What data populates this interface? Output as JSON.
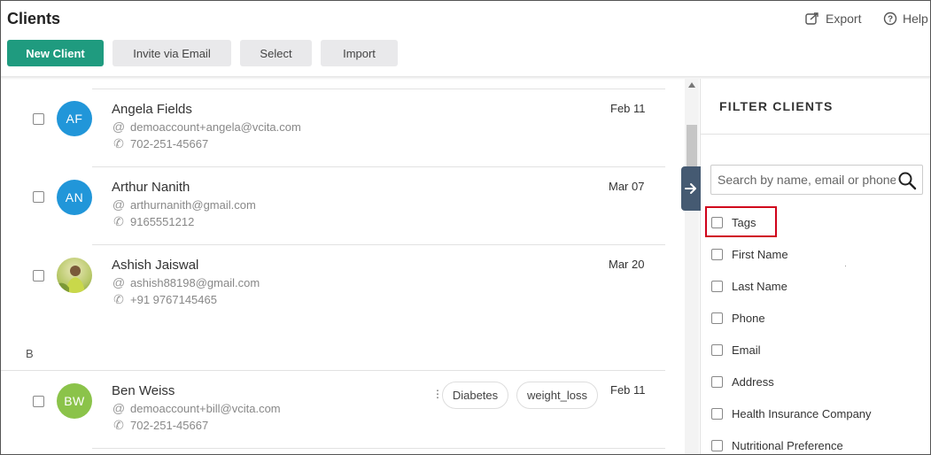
{
  "app": {
    "title": "Clients"
  },
  "top_links": {
    "export_label": "Export",
    "help_label": "Help"
  },
  "toolbar": {
    "new_client_label": "New Client",
    "invite_label": "Invite via Email",
    "select_label": "Select",
    "import_label": "Import"
  },
  "clients": [
    {
      "initials": "AF",
      "avatar_color": "#2196d9",
      "name": "Angela Fields",
      "email": "demoaccount+angela@vcita.com",
      "phone": "702-251-45667",
      "date": "Feb 11"
    },
    {
      "initials": "AN",
      "avatar_color": "#2196d9",
      "name": "Arthur Nanith",
      "email": "arthurnanith@gmail.com",
      "phone": "9165551212",
      "date": "Mar 07"
    },
    {
      "initials": "",
      "avatar_color": "#9bbd4a",
      "name": "Ashish Jaiswal",
      "email": "ashish88198@gmail.com",
      "phone": "+91 9767145465",
      "date": "Mar 20"
    },
    {
      "initials": "BW",
      "avatar_color": "#8bc34a",
      "name": "Ben Weiss",
      "email": "demoaccount+bill@vcita.com",
      "phone": "702-251-45667",
      "date": "Feb 11",
      "tags": [
        "Diabetes",
        "weight_loss"
      ]
    }
  ],
  "sections": {
    "b_letter": "B"
  },
  "icons": {
    "email_glyph": "@",
    "phone_glyph": "✆"
  },
  "filter": {
    "title": "FILTER CLIENTS",
    "search_placeholder": "Search by name, email or phone",
    "options": [
      "Tags",
      "First Name",
      "Last Name",
      "Phone",
      "Email",
      "Address",
      "Health Insurance Company",
      "Nutritional Preference"
    ],
    "highlighted_option": "Tags"
  },
  "colors": {
    "accent": "#1f9b7f",
    "toggle_tab": "#455a72",
    "highlight": "#d0021b"
  }
}
